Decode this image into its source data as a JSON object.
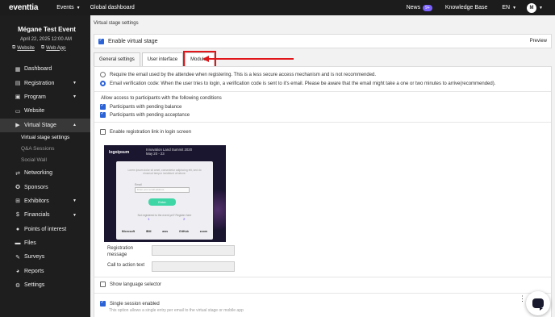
{
  "topbar": {
    "logo": "eventtia",
    "events": "Events",
    "global_dashboard": "Global dashboard",
    "news": "News",
    "news_badge": "9+",
    "knowledge_base": "Knowledge Base",
    "language": "EN",
    "avatar_initial": "M"
  },
  "sidebar": {
    "event_title": "Mégane Test Event",
    "event_date": "April 22, 2025 12:00 AM",
    "website_link": "Website",
    "webapp_link": "Web App",
    "items": [
      {
        "label": "Dashboard",
        "icon": "dashboard-icon"
      },
      {
        "label": "Registration",
        "icon": "registration-icon",
        "chevron": true
      },
      {
        "label": "Program",
        "icon": "program-icon",
        "chevron": true
      },
      {
        "label": "Website",
        "icon": "website-icon"
      },
      {
        "label": "Virtual Stage",
        "icon": "virtual-stage-icon",
        "chevron": true,
        "expanded": true
      }
    ],
    "sub_items": [
      "Virtual stage settings",
      "Q&A Sessions",
      "Social Wall"
    ],
    "items_after": [
      {
        "label": "Networking",
        "icon": "networking-icon"
      },
      {
        "label": "Sponsors",
        "icon": "sponsors-icon"
      },
      {
        "label": "Exhibitors",
        "icon": "exhibitors-icon",
        "chevron": true
      },
      {
        "label": "Financials",
        "icon": "financials-icon",
        "chevron": true
      },
      {
        "label": "Points of interest",
        "icon": "location-icon"
      },
      {
        "label": "Files",
        "icon": "files-icon"
      },
      {
        "label": "Surveys",
        "icon": "surveys-icon"
      },
      {
        "label": "Reports",
        "icon": "reports-icon"
      },
      {
        "label": "Settings",
        "icon": "settings-icon"
      }
    ]
  },
  "main": {
    "page_title": "Virtual stage settings",
    "enable_virtual_stage": "Enable virtual stage",
    "preview": "Preview",
    "tabs": [
      "General settings",
      "User interface",
      "Modules"
    ],
    "radio_1": "Require the email used by the attendee when registering. This is a less secure access mechanism and is not recommended.",
    "radio_2": "Email verification code: When the user tries to login, a verification code is sent to it's email. Please be aware that the email might take a one or two minutes to arrive(recommended).",
    "allow_access": "Allow access to participants with the following conditions",
    "pending_balance": "Participants with pending balance",
    "pending_acceptance": "Participants with pending acceptance",
    "enable_registration_link": "Enable registration link in login screen",
    "registration_message": "Registration message",
    "call_to_action": "Call to action text",
    "show_language_selector": "Show language selector",
    "single_session": "Single session enabled",
    "single_session_help": "This option allows a single entry per email to the virtual stage or mobile app"
  },
  "login_preview": {
    "logo": "logoipsum",
    "summit": "Innovation Land Summit 2020",
    "summit_date": "May 20 - 23",
    "lorem": "Lorem ipsum dolor sit amet, consectetur adipiscing elit, sed do eiusmod tempor incididunt ut labore.",
    "email_label": "Email",
    "email_placeholder": "Enter your email address",
    "enter_button": "Enter",
    "register_text": "Not registered to the event yet? Register here",
    "step_1": "1",
    "step_2": "2",
    "sponsors": [
      "Microsoft",
      "IBM",
      "aws",
      "GitHub",
      "zoom"
    ]
  },
  "colors": {
    "accent": "#2b62d6",
    "highlight": "#e0161b",
    "sidebar_bg": "#1e1e1e",
    "topbar_bg": "#1c1c1c"
  }
}
